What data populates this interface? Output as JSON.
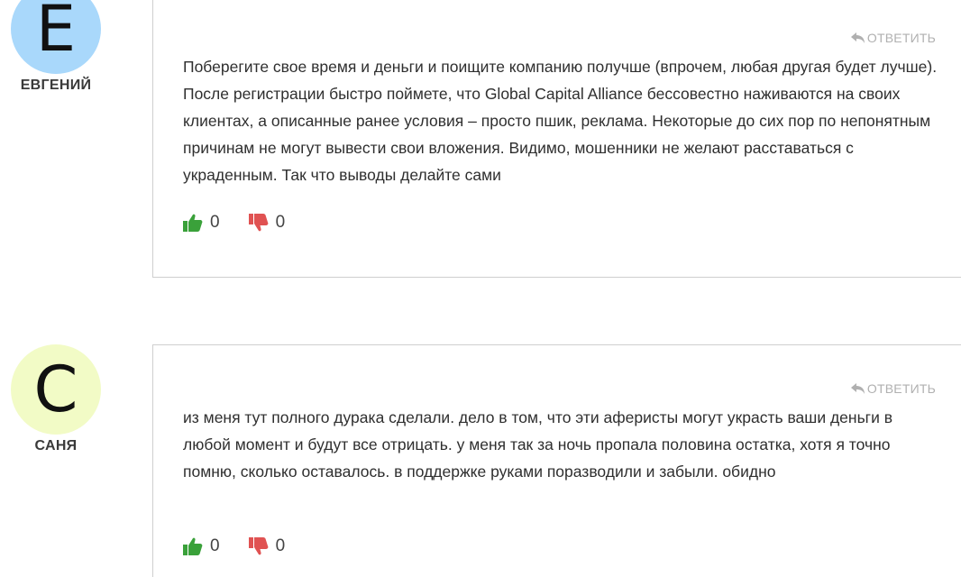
{
  "comments": [
    {
      "avatar_letter": "E",
      "avatar_color": "#a9d8fb",
      "author": "ЕВГЕНИЙ",
      "reply_label": "ОТВЕТИТЬ",
      "text": "Поберегите свое время и деньги и поищите компанию получше (впрочем, любая другая будет лучше). После регистрации быстро поймете, что Global Capital Alliance бессовестно наживаются на своих клиентах, а описанные ранее условия – просто пшик, реклама. Некоторые до сих пор по непонятным причинам не могут вывести свои вложения. Видимо, мошенники не желают расставаться с украденным. Так что выводы делайте сами",
      "likes": "0",
      "dislikes": "0"
    },
    {
      "avatar_letter": "C",
      "avatar_color": "#f2fbc6",
      "author": "САНЯ",
      "reply_label": "ОТВЕТИТЬ",
      "text": "из меня тут полного дурака сделали. дело в том, что эти аферисты могут украсть ваши деньги в любой момент и будут все отрицать. у меня так за ночь пропала половина остатка, хотя я точно помню, сколько оставалось. в поддержке руками поразводили и забыли. обидно",
      "likes": "0",
      "dislikes": "0"
    }
  ],
  "icons": {
    "reply": "reply-arrow-icon",
    "like": "thumbs-up-icon",
    "dislike": "thumbs-down-icon"
  },
  "colors": {
    "like": "#3aa13a",
    "dislike": "#e05252",
    "reply": "#b0b0b0",
    "border": "#cfcfcf"
  }
}
